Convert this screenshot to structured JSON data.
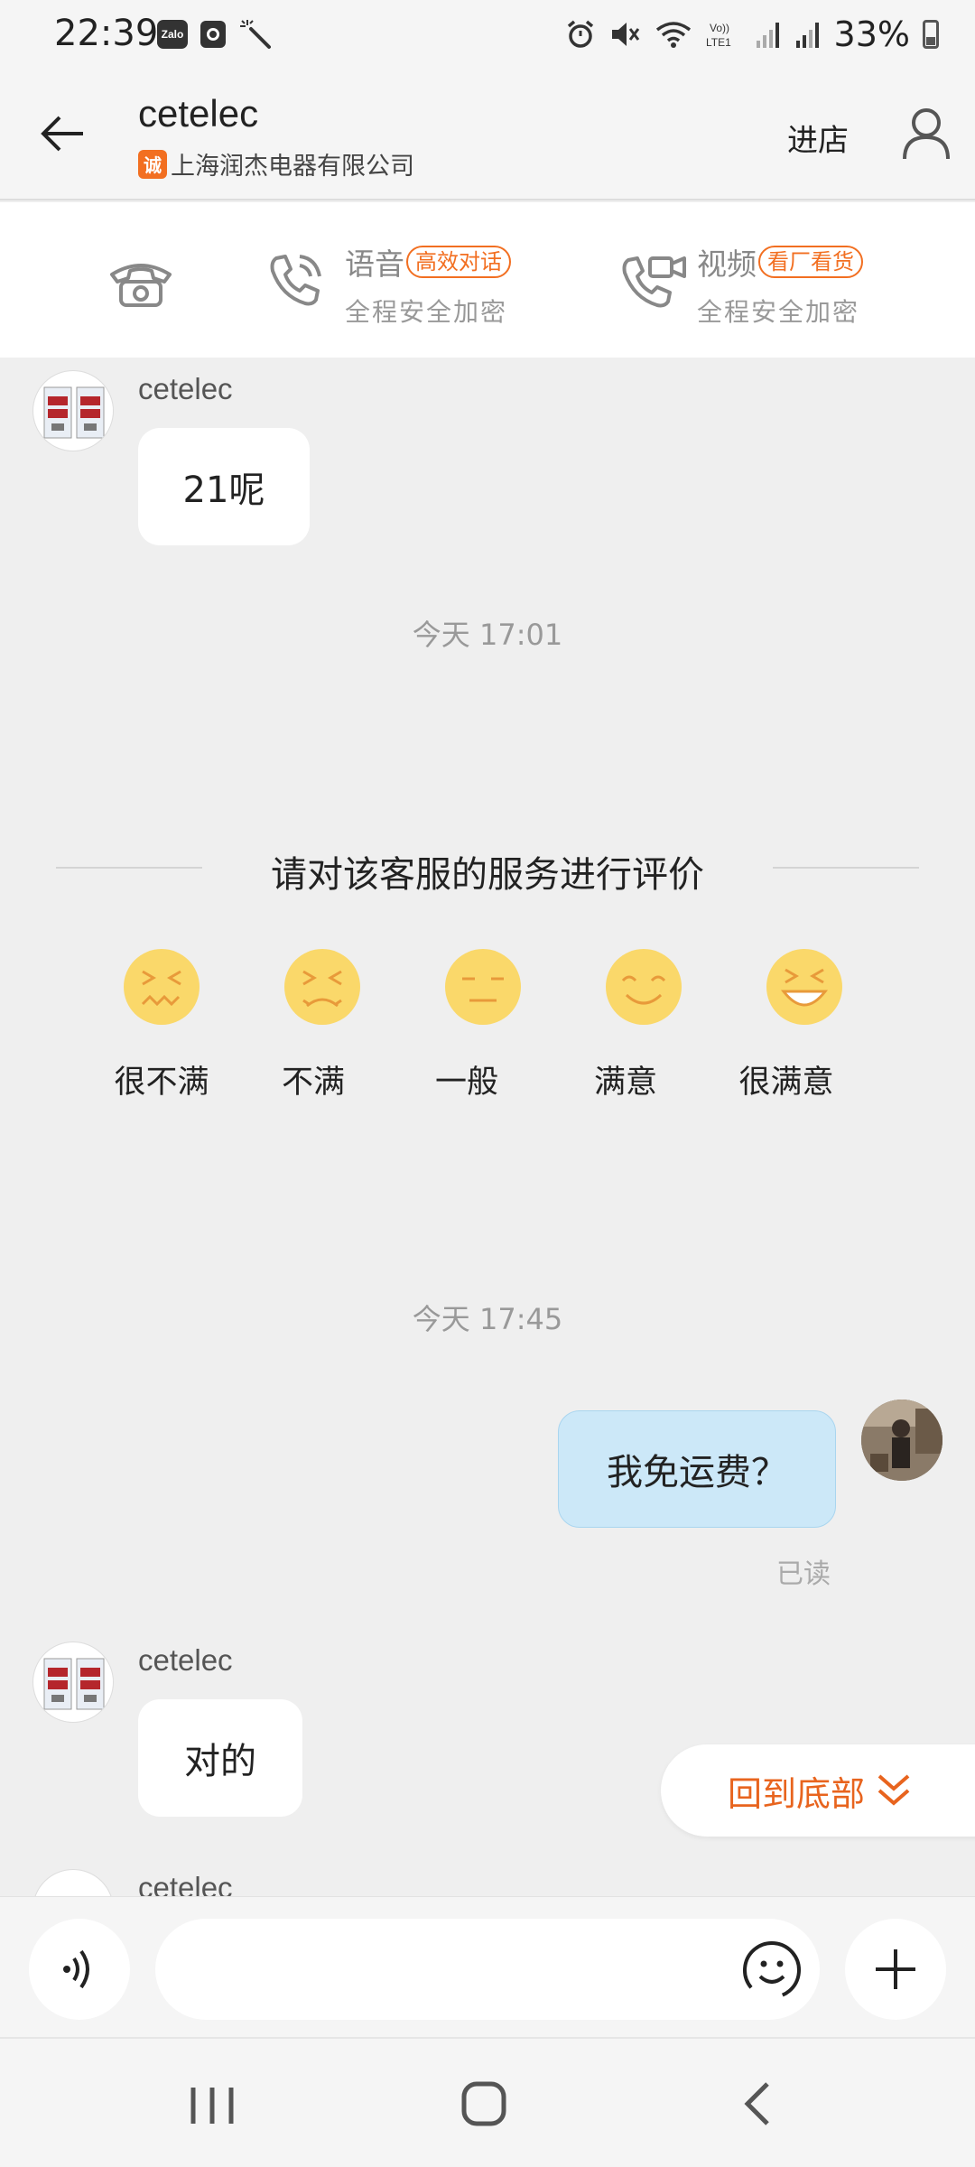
{
  "status_bar": {
    "time": "22:39",
    "zalo_label": "Zalo",
    "battery": "33%"
  },
  "header": {
    "title": "cetelec",
    "badge_glyph": "诚",
    "company": "上海润杰电器有限公司",
    "enter_shop": "进店"
  },
  "call_panel": {
    "voice": {
      "label": "语音",
      "tag": "高效对话",
      "sub": "全程安全加密"
    },
    "video": {
      "label": "视频",
      "tag": "看厂看货",
      "sub": "全程安全加密"
    }
  },
  "chat": {
    "msg1": {
      "sender": "cetelec",
      "text": "21呢"
    },
    "time1": "今天  17:01",
    "rating": {
      "title": "请对该客服的服务进行评价",
      "options": [
        "很不满",
        "不满",
        "一般",
        "满意",
        "很满意"
      ]
    },
    "time2": "今天  17:45",
    "msg2": {
      "text": "我免运费？",
      "status": "已读"
    },
    "msg3": {
      "sender": "cetelec",
      "text": "对的"
    },
    "msg4": {
      "sender": "cetelec"
    }
  },
  "scroll_bottom": {
    "label": "回到底部"
  },
  "input": {
    "placeholder": ""
  },
  "colors": {
    "accent": "#f26f21",
    "outgoing_bubble": "#cce8f8",
    "face": "#fad86a"
  }
}
